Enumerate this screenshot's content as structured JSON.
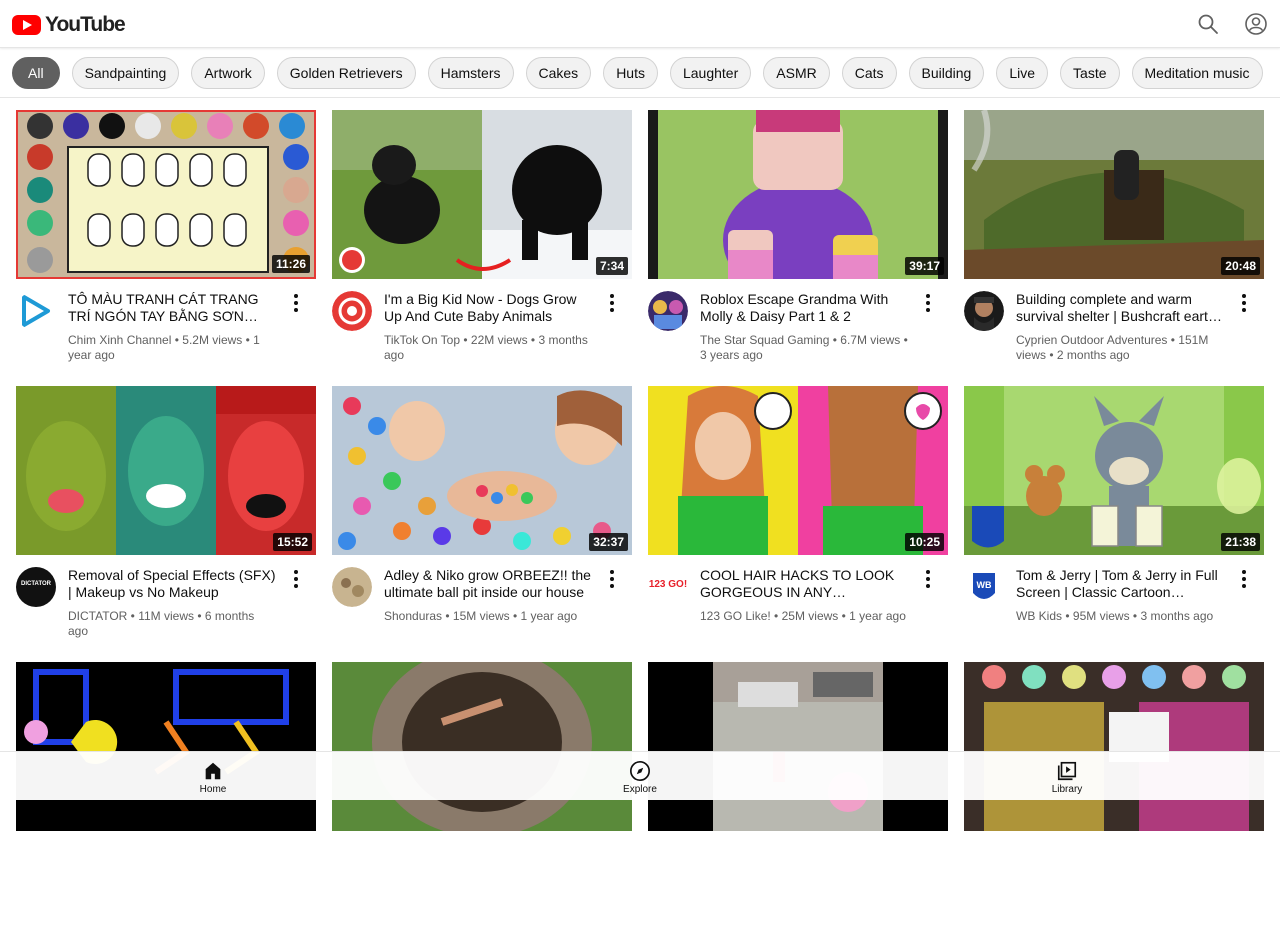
{
  "header": {
    "logo_text": "YouTube"
  },
  "chips": [
    "All",
    "Sandpainting",
    "Artwork",
    "Golden Retrievers",
    "Hamsters",
    "Cakes",
    "Huts",
    "Laughter",
    "ASMR",
    "Cats",
    "Building",
    "Live",
    "Taste",
    "Meditation music"
  ],
  "active_chip": "All",
  "videos": [
    {
      "title": "TÔ MÀU TRANH CÁT TRANG TRÍ NGÓN TAY BẰNG SƠN MÓNG TAY...",
      "channel": "Chim Xinh Channel",
      "views": "5.2M views",
      "age": "1 year ago",
      "duration": "11:26"
    },
    {
      "title": "I'm a Big Kid Now - Dogs Grow Up And Cute Baby Animals",
      "channel": "TikTok On Top",
      "views": "22M views",
      "age": "3 months ago",
      "duration": "7:34"
    },
    {
      "title": "Roblox Escape Grandma With Molly & Daisy Part 1 & 2",
      "channel": "The Star Squad Gaming",
      "views": "6.7M views",
      "age": "3 years ago",
      "duration": "39:17"
    },
    {
      "title": "Building complete and warm survival shelter | Bushcraft earth hut",
      "channel": "Cyprien Outdoor Adventures",
      "views": "151M views",
      "age": "2 months ago",
      "duration": "20:48"
    },
    {
      "title": "Removal of Special Effects (SFX) | Makeup vs No Makeup",
      "channel": "DICTATOR",
      "views": "11M views",
      "age": "6 months ago",
      "duration": "15:52"
    },
    {
      "title": "Adley & Niko grow ORBEEZ!! the ultimate ball pit inside our house",
      "channel": "Shonduras",
      "views": "15M views",
      "age": "1 year ago",
      "duration": "32:37"
    },
    {
      "title": "COOL HAIR HACKS TO LOOK GORGEOUS IN ANY SITUATION || Easy...",
      "channel": "123 GO Like!",
      "views": "25M views",
      "age": "1 year ago",
      "duration": "10:25"
    },
    {
      "title": "Tom & Jerry | Tom & Jerry in Full Screen | Classic Cartoon Compilation",
      "channel": "WB Kids",
      "views": "95M views",
      "age": "3 months ago",
      "duration": "21:38"
    },
    {
      "title": "",
      "channel": "",
      "views": "",
      "age": "",
      "duration": ""
    },
    {
      "title": "",
      "channel": "",
      "views": "",
      "age": "",
      "duration": ""
    },
    {
      "title": "",
      "channel": "",
      "views": "",
      "age": "",
      "duration": ""
    },
    {
      "title": "",
      "channel": "",
      "views": "",
      "age": "",
      "duration": ""
    }
  ],
  "avatar_labels": {
    "dictator": "DICTATOR",
    "go": "123 GO!",
    "wb": "WB"
  },
  "bottom_nav": [
    {
      "label": "Home",
      "icon": "home-icon"
    },
    {
      "label": "Explore",
      "icon": "compass-icon"
    },
    {
      "label": "Library",
      "icon": "library-icon"
    }
  ],
  "colors": {
    "brand": "#ff0000",
    "chip_active": "#606060",
    "chip_bg": "#f2f2f2",
    "meta_text": "#606060"
  }
}
